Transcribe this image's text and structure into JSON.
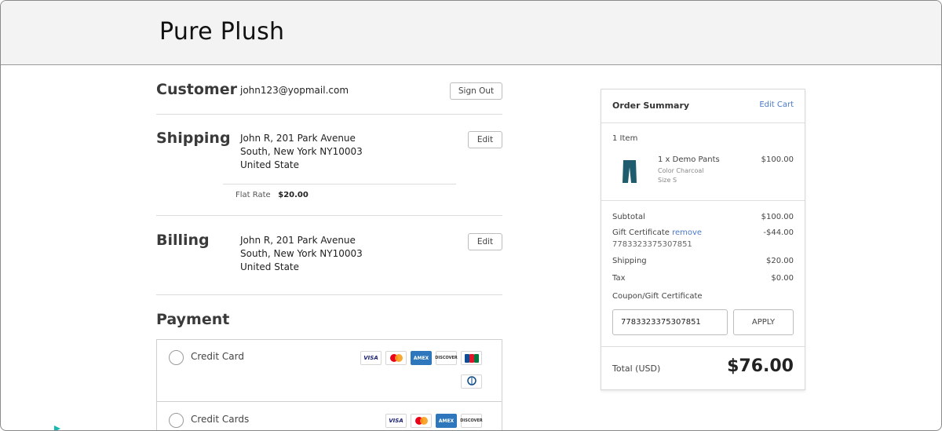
{
  "header": {
    "brand": "Pure Plush"
  },
  "customer": {
    "title": "Customer",
    "email": "john123@yopmail.com",
    "sign_out_label": "Sign Out"
  },
  "shipping": {
    "title": "Shipping",
    "address_line1": "John R, 201 Park Avenue",
    "address_line2": "South, New York NY10003",
    "address_line3": "United State",
    "edit_label": "Edit",
    "method_label": "Flat Rate",
    "method_price": "$20.00"
  },
  "billing": {
    "title": "Billing",
    "address_line1": "John R, 201 Park Avenue",
    "address_line2": "South, New York NY10003",
    "address_line3": "United State",
    "edit_label": "Edit"
  },
  "payment": {
    "title": "Payment",
    "options": [
      {
        "label": "Credit Card",
        "cards": [
          "VISA",
          "mastercard",
          "AMEX",
          "DISCOVER",
          "JCB",
          "Diners Club"
        ]
      },
      {
        "label": "Credit Cards",
        "cards": [
          "VISA",
          "mastercard",
          "AMEX",
          "DISCOVER"
        ]
      }
    ]
  },
  "summary": {
    "title": "Order Summary",
    "edit_cart_label": "Edit Cart",
    "item_count": "1 Item",
    "item": {
      "name": "1 x Demo Pants",
      "color": "Color Charcoal",
      "size": "Size S",
      "price": "$100.00"
    },
    "subtotal_label": "Subtotal",
    "subtotal_value": "$100.00",
    "gift_label": "Gift Certificate",
    "gift_remove_label": "remove",
    "gift_value": "-$44.00",
    "gift_code": "7783323375307851",
    "shipping_label": "Shipping",
    "shipping_value": "$20.00",
    "tax_label": "Tax",
    "tax_value": "$0.00",
    "coupon_label": "Coupon/Gift Certificate",
    "coupon_input_value": "7783323375307851",
    "apply_label": "APPLY",
    "total_label": "Total (USD)",
    "total_value": "$76.00"
  },
  "colors": {
    "link": "#4a78c8",
    "pants": "#1f5d6e",
    "visa": "#1a1f71",
    "amex": "#2e77bc",
    "mc_red": "#eb001b",
    "mc_orange": "#f79e1b"
  }
}
